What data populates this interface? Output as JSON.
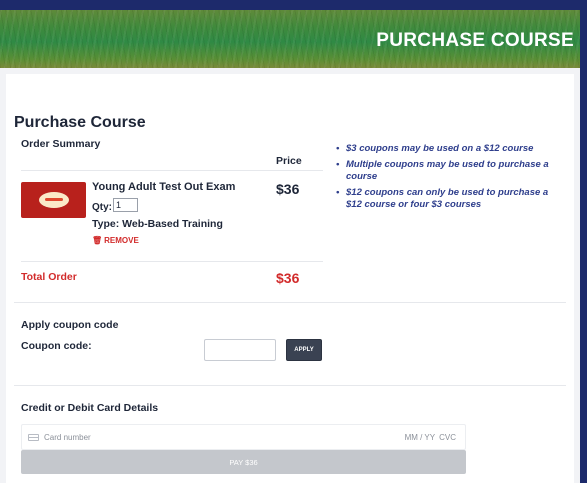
{
  "banner": {
    "title": "PURCHASE COURSE"
  },
  "page": {
    "heading": "Purchase Course"
  },
  "order": {
    "summary_label": "Order Summary",
    "price_header": "Price",
    "item": {
      "icon": "course-logo-icon",
      "name": "Young Adult Test Out Exam",
      "qty_label": "Qty:",
      "qty_value": "1",
      "type": "Type: Web-Based Training",
      "remove_label": "REMOVE",
      "price": "$36"
    },
    "total_label": "Total Order",
    "total_value": "$36"
  },
  "notes": [
    "$3 coupons may be used on a $12 course",
    "Multiple coupons may be used to purchase a course",
    "$12 coupons can only be used to purchase a $12 course or four $3 courses"
  ],
  "coupon": {
    "heading": "Apply coupon code",
    "label": "Coupon code:",
    "value": "",
    "apply_label": "APPLY"
  },
  "payment": {
    "heading": "Credit or Debit Card Details",
    "card_number_placeholder": "Card number",
    "exp_placeholder": "MM / YY",
    "cvc_placeholder": "CVC",
    "pay_label": "PAY $36"
  },
  "colors": {
    "accent_red": "#d22b2b",
    "navy_frame": "#1d2a6b",
    "note_blue": "#2e3e8c",
    "banner_green": "#3f8a3c"
  }
}
